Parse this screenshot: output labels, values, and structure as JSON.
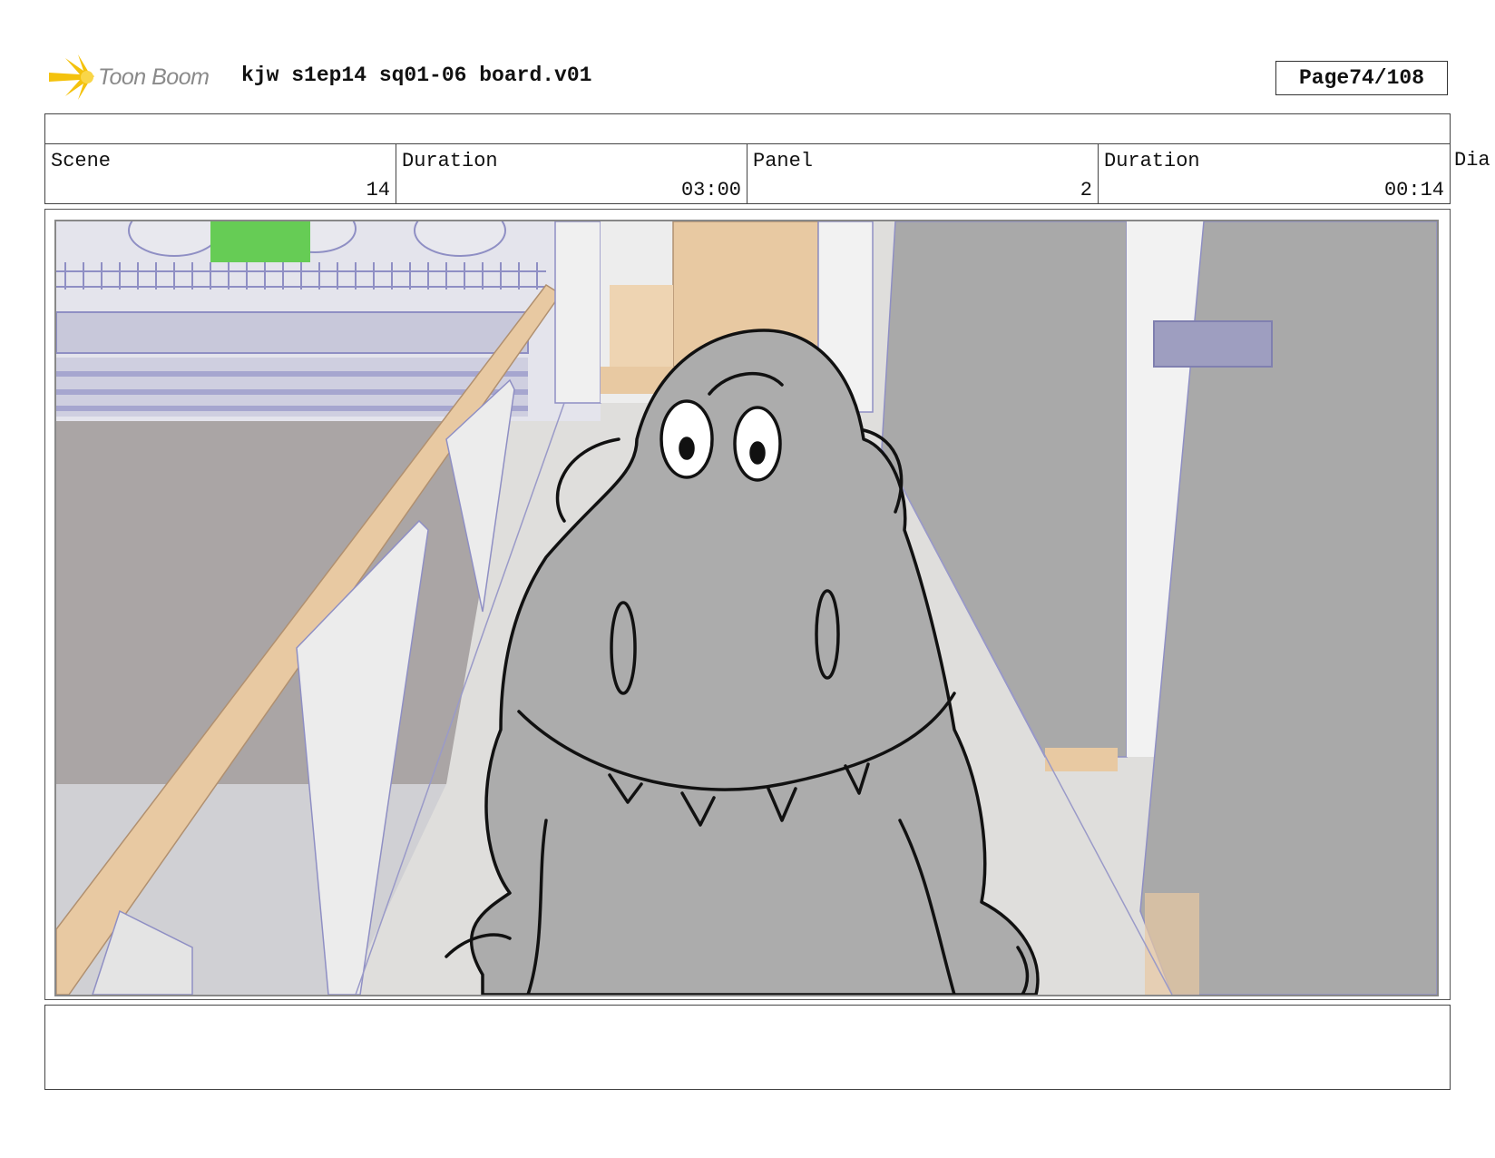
{
  "header": {
    "logo_text": "Toon Boom",
    "document_title": "kjw s1ep14 sq01-06 board.v01",
    "page_label": "Page",
    "page_number": "74/108"
  },
  "info": {
    "scene_label": "Scene",
    "scene_value": "14",
    "scene_duration_label": "Duration",
    "scene_duration_value": "03:00",
    "panel_label": "Panel",
    "panel_value": "2",
    "panel_duration_label": "Duration",
    "panel_duration_value": "00:14",
    "dialogue_label": "Dia"
  },
  "colors": {
    "wall_dark": "#a9a9a9",
    "floor": "#dfdedc",
    "wood": "#e8c9a2",
    "wire": "#8f8fc4",
    "character": "#acacac",
    "logo_yellow": "#f4c20d"
  }
}
